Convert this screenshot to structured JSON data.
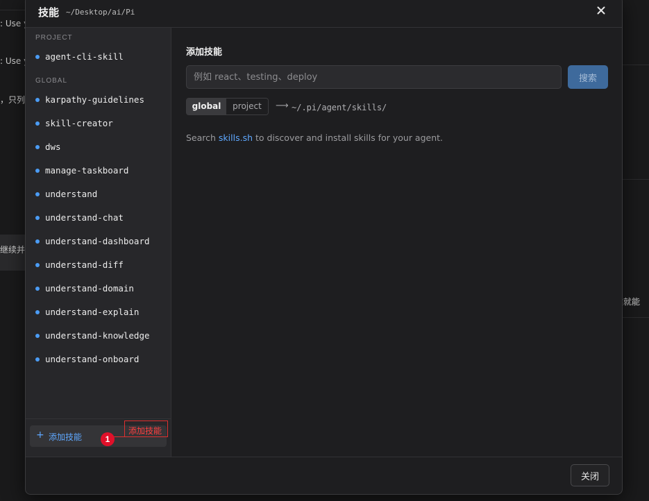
{
  "background": {
    "fragments": [
      ": Use y",
      ": Use y",
      "，只列",
      "继续并提",
      "键就能"
    ]
  },
  "dialog": {
    "title": "技能",
    "path": "~/Desktop/ai/Pi",
    "close_icon": "close-icon"
  },
  "sidebar": {
    "project_label": "PROJECT",
    "project_items": [
      {
        "label": "agent-cli-skill"
      }
    ],
    "global_label": "GLOBAL",
    "global_items": [
      {
        "label": "karpathy-guidelines"
      },
      {
        "label": "skill-creator"
      },
      {
        "label": "dws"
      },
      {
        "label": "manage-taskboard"
      },
      {
        "label": "understand"
      },
      {
        "label": "understand-chat"
      },
      {
        "label": "understand-dashboard"
      },
      {
        "label": "understand-diff"
      },
      {
        "label": "understand-domain"
      },
      {
        "label": "understand-explain"
      },
      {
        "label": "understand-knowledge"
      },
      {
        "label": "understand-onboard"
      }
    ],
    "add_button": {
      "icon": "plus-icon",
      "plus": "+",
      "label": "添加技能"
    },
    "annotation": {
      "badge": "1",
      "label": "添加技能"
    }
  },
  "main": {
    "title": "添加技能",
    "search": {
      "placeholder": "例如 react、testing、deploy",
      "value": "",
      "button": "搜索"
    },
    "scope": {
      "options": [
        "global",
        "project"
      ],
      "selected": "global",
      "arrow": "⟶",
      "path": "~/.pi/agent/skills/"
    },
    "discover": {
      "prefix": "Search ",
      "link": "skills.sh",
      "suffix": " to discover and install skills for your agent."
    }
  },
  "footer": {
    "close_label": "关闭"
  },
  "colors": {
    "accent": "#4b9cf5",
    "annotation": "#e0102a"
  }
}
